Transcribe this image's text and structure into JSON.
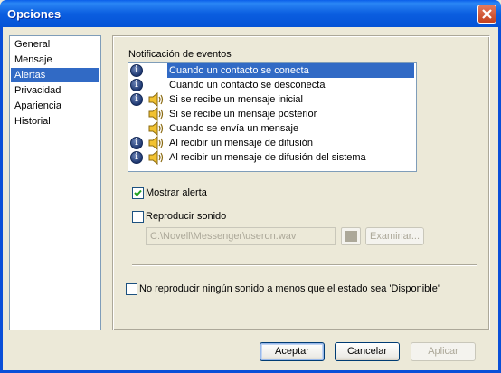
{
  "window": {
    "title": "Opciones"
  },
  "nav": {
    "items": [
      {
        "label": "General",
        "selected": false
      },
      {
        "label": "Mensaje",
        "selected": false
      },
      {
        "label": "Alertas",
        "selected": true
      },
      {
        "label": "Privacidad",
        "selected": false
      },
      {
        "label": "Apariencia",
        "selected": false
      },
      {
        "label": "Historial",
        "selected": false
      }
    ]
  },
  "events": {
    "group_label": "Notificación de eventos",
    "items": [
      {
        "label": "Cuando un contacto se conecta",
        "info": true,
        "sound": false,
        "selected": true
      },
      {
        "label": "Cuando un contacto se desconecta",
        "info": true,
        "sound": false,
        "selected": false
      },
      {
        "label": "Si se recibe un mensaje inicial",
        "info": true,
        "sound": true,
        "selected": false
      },
      {
        "label": "Si se recibe un mensaje posterior",
        "info": false,
        "sound": true,
        "selected": false
      },
      {
        "label": "Cuando se envía un mensaje",
        "info": false,
        "sound": true,
        "selected": false
      },
      {
        "label": "Al recibir un mensaje de difusión",
        "info": true,
        "sound": true,
        "selected": false
      },
      {
        "label": "Al recibir un mensaje de difusión del sistema",
        "info": true,
        "sound": true,
        "selected": false
      }
    ]
  },
  "options": {
    "show_alert": {
      "label": "Mostrar alerta",
      "checked": true
    },
    "play_sound": {
      "label": "Reproducir sonido",
      "checked": false
    },
    "sound_path": "C:\\Novell\\Messenger\\useron.wav",
    "browse_label": "Examinar...",
    "no_sound_unless_available": {
      "label": "No reproducir ningún sonido a menos que el estado sea 'Disponible'",
      "checked": false
    }
  },
  "buttons": {
    "accept": "Aceptar",
    "cancel": "Cancelar",
    "apply": "Aplicar"
  },
  "colors": {
    "selection": "#316AC5",
    "titlebar": "#0A5EEA",
    "face": "#ECE9D8"
  }
}
